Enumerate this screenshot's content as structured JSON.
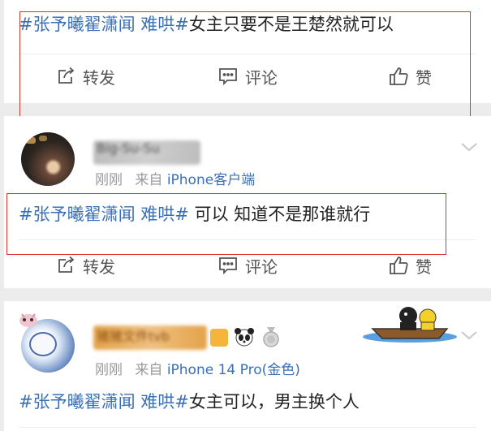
{
  "posts": [
    {
      "topic": "#张予曦翟潇闻 难哄#",
      "text": "女主只要不是王楚然就可以"
    },
    {
      "username": "Big-Su-Su",
      "meta": {
        "time": "刚刚",
        "from": "来自",
        "device": "iPhone客户端"
      },
      "topic": "#张予曦翟潇闻 难哄#",
      "text": " 可以 知道不是那谁就行"
    },
    {
      "username": "猪猪文件tvb",
      "meta": {
        "time": "刚刚",
        "from": "来自",
        "device": "iPhone 14 Pro(金色)"
      },
      "topic": "#张予曦翟潇闻 难哄#",
      "text": "女主可以，男主换个人"
    }
  ],
  "actions": {
    "repost": "转发",
    "comment": "评论",
    "like": "赞"
  },
  "colors": {
    "topic": "#3b6fb6",
    "highlight": "#d9342b",
    "icon": "#555555"
  },
  "icons": [
    "repost-icon",
    "comment-icon",
    "like-icon",
    "chevron-down-icon",
    "panda-icon",
    "medal-icon",
    "boat-sticker"
  ]
}
